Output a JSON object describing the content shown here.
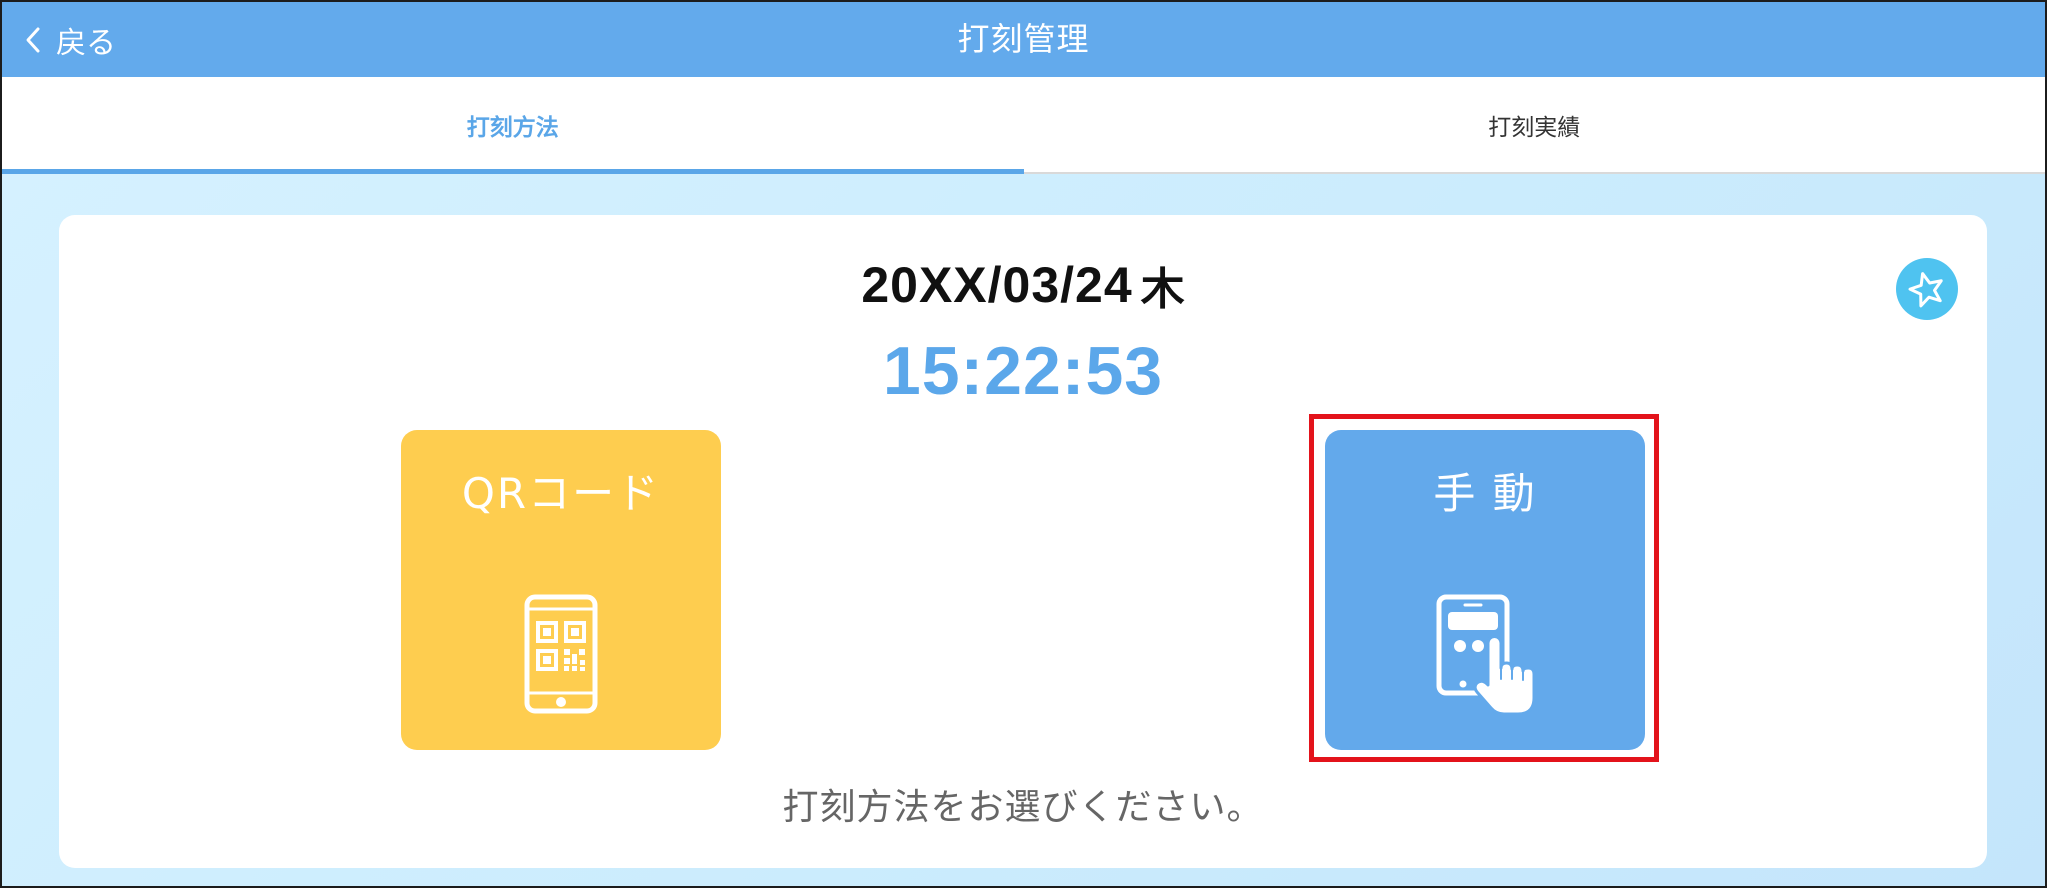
{
  "header": {
    "back_label": "戻る",
    "back_icon": "chevron-left-icon",
    "title": "打刻管理"
  },
  "tabs": [
    {
      "label": "打刻方法",
      "active": true
    },
    {
      "label": "打刻実績",
      "active": false
    }
  ],
  "clock": {
    "date": "20XX/03/24",
    "weekday": "木",
    "time": "15:22:53"
  },
  "favorite_button": {
    "icon": "star-icon"
  },
  "methods": [
    {
      "label": "QRコード",
      "icon": "qr-code-phone-icon"
    },
    {
      "label": "手 動",
      "icon": "tablet-touch-icon",
      "highlighted": true
    }
  ],
  "instruction": "打刻方法をお選びください。",
  "colors": {
    "header_bg": "#63aaec",
    "tab_active": "#5aa6e8",
    "time_text": "#5ba7ea",
    "qr_button": "#fecd4f",
    "manual_button": "#63a9eb",
    "favorite_button": "#4fc3f0",
    "highlight_frame": "#e3131b",
    "content_bg": "#cbecfd"
  }
}
